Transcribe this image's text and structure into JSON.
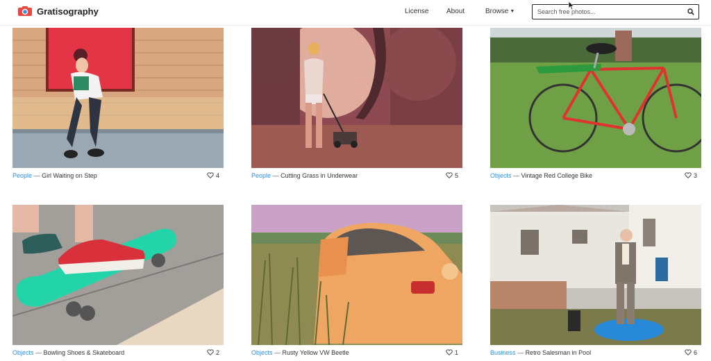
{
  "header": {
    "brand": "Gratisography",
    "nav": [
      "License",
      "About",
      "Browse"
    ],
    "search_placeholder": "Search free photos..."
  },
  "separator": "—",
  "photos": [
    {
      "category": "People",
      "title": "Girl Waiting on Step",
      "likes": "4"
    },
    {
      "category": "People",
      "title": "Cutting Grass in Underwear",
      "likes": "5"
    },
    {
      "category": "Objects",
      "title": "Vintage Red College Bike",
      "likes": "3"
    },
    {
      "category": "Objects",
      "title": "Bowling Shoes & Skateboard",
      "likes": "2"
    },
    {
      "category": "Objects",
      "title": "Rusty Yellow VW Beetle",
      "likes": "1"
    },
    {
      "category": "Business",
      "title": "Retro Salesman in Pool",
      "likes": "6"
    }
  ],
  "colors": {
    "link": "#2b8fe0",
    "logo_red": "#e8483f",
    "logo_blue": "#3a8ee6"
  },
  "icons": {
    "search": "search-icon",
    "like": "heart-icon",
    "logo": "camera-logo-icon"
  }
}
